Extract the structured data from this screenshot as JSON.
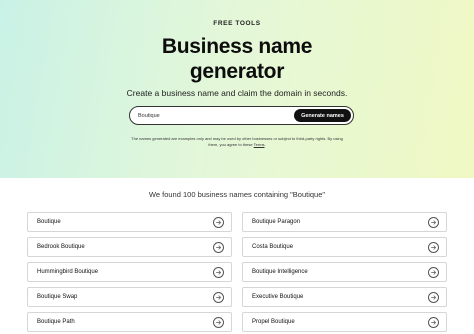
{
  "hero": {
    "eyebrow": "FREE TOOLS",
    "title_line1": "Business name",
    "title_line2": "generator",
    "subtitle": "Create a business name and claim the domain in seconds.",
    "search_value": "Boutique",
    "generate_label": "Generate names",
    "disclaimer_text": "The names generated are examples only and may be used by other businesses or subject to third-party rights. By using them, you agree to these",
    "terms_link": "Terms"
  },
  "results": {
    "heading": "We found 100 business names containing \"Boutique\"",
    "items": [
      {
        "label": "Boutique"
      },
      {
        "label": "Boutique Paragon"
      },
      {
        "label": "Bedrook Boutique"
      },
      {
        "label": "Costa Boutique"
      },
      {
        "label": "Hummingbird Boutique"
      },
      {
        "label": "Boutique Intelligence"
      },
      {
        "label": "Boutique Swap"
      },
      {
        "label": "Executive Boutique"
      },
      {
        "label": "Boutique Path"
      },
      {
        "label": "Propel Boutique"
      }
    ],
    "arrow_icon": "arrow-right-circle-icon"
  },
  "colors": {
    "hero_gradient_start": "#c9f2e6",
    "hero_gradient_end": "#f0f9c4",
    "button_bg": "#111111"
  }
}
